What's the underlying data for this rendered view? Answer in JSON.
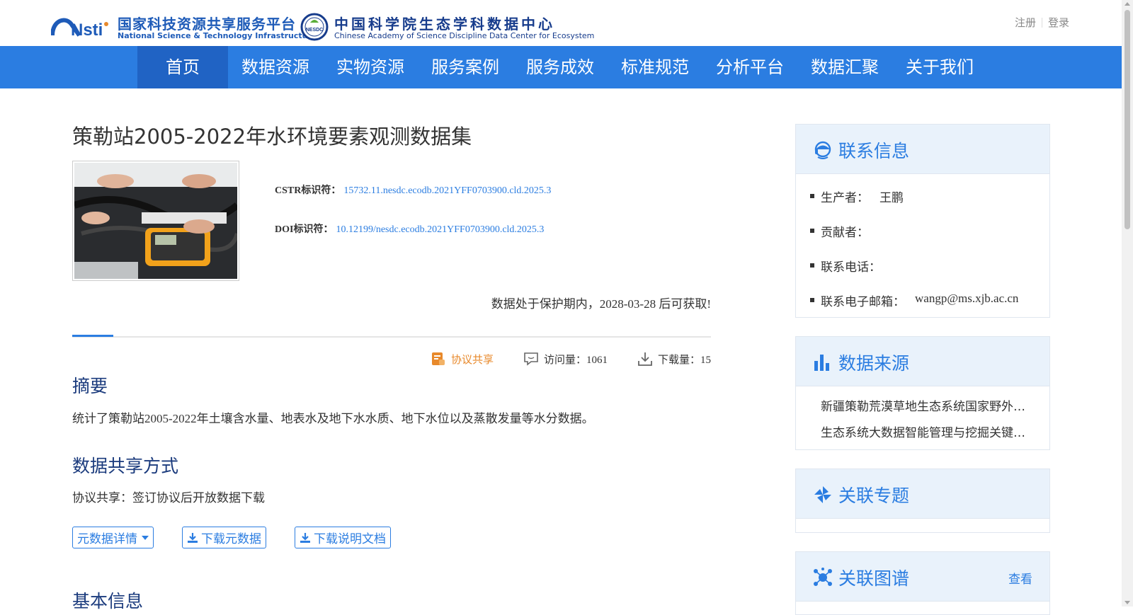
{
  "header": {
    "logo1": {
      "mark": "Nsti",
      "cn": "国家科技资源共享服务平台",
      "en": "National Science & Technology Infrastructure"
    },
    "logo2": {
      "seal": "NESDC",
      "cn": "中国科学院生态学科数据中心",
      "en": "Chinese Academy of Science Discipline Data Center for Ecosystem"
    },
    "register": "注册",
    "login": "登录"
  },
  "nav": {
    "items": [
      "首页",
      "数据资源",
      "实物资源",
      "服务案例",
      "服务成效",
      "标准规范",
      "分析平台",
      "数据汇聚",
      "关于我们"
    ],
    "active": "首页"
  },
  "dataset": {
    "title": "策勒站2005-2022年水环境要素观测数据集",
    "cstr_label": "CSTR标识符：",
    "cstr_value": "15732.11.nesdc.ecodb.2021YFF0703900.cld.2025.3",
    "doi_label": "DOI标识符：",
    "doi_value": "10.12199/nesdc.ecodb.2021YFF0703900.cld.2025.3",
    "protect_notice": "数据处于保护期内，2028-03-28 后可获取!",
    "stats": {
      "share_type": "协议共享",
      "visits": "访问量：1061",
      "downloads": "下载量：15"
    },
    "abstract_heading": "摘要",
    "abstract_text": "统计了策勒站2005-2022年土壤含水量、地表水及地下水水质、地下水位以及蒸散发量等水分数据。",
    "sharing_heading": "数据共享方式",
    "sharing_text": "协议共享：签订协议后开放数据下载",
    "buttons": {
      "metadata": "元数据详情",
      "download_meta": "下载元数据",
      "download_doc": "下载说明文档"
    },
    "next_heading": "基本信息"
  },
  "sidebar": {
    "contact": {
      "title": "联系信息",
      "rows": [
        {
          "k": "生产者：",
          "v": "王鹏"
        },
        {
          "k": "贡献者：",
          "v": ""
        },
        {
          "k": "联系电话：",
          "v": ""
        },
        {
          "k": "联系电子邮箱：",
          "v": "wangp@ms.xjb.ac.cn"
        }
      ]
    },
    "source": {
      "title": "数据来源",
      "items": [
        "新疆策勒荒漠草地生态系统国家野外科学观测研究站",
        "生态系统大数据智能管理与挖掘关键技术"
      ]
    },
    "topic": {
      "title": "关联专题"
    },
    "graph": {
      "title": "关联图谱",
      "more": "查看"
    }
  },
  "colors": {
    "nav": "#2b7de1",
    "nav_active": "#2063c4",
    "heading": "#1b3b7d",
    "accent": "#2b7de1",
    "orange": "#e8892b"
  }
}
